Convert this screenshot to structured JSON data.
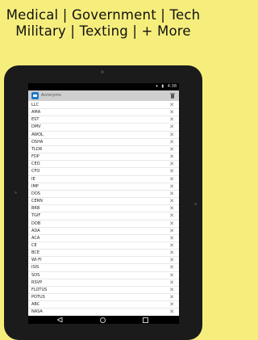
{
  "banner": {
    "line1": "Medical | Government | Tech",
    "line2": "Military | Texting | + More"
  },
  "statusbar": {
    "icons": [
      "wifi-icon",
      "battery-icon"
    ],
    "time": "4:38"
  },
  "toolbar": {
    "title": "Acronyms",
    "icon": "app-icon",
    "action_icon": "trash-icon"
  },
  "list": {
    "items": [
      "LLC",
      "AMA",
      "EST",
      "DMV",
      "AWOL",
      "OSHA",
      "TLDR",
      "FDP",
      "CEO",
      "CFO",
      "IE",
      "IMP",
      "DOS",
      "CERN",
      "BRB",
      "TGIF",
      "DOB",
      "ADA",
      "ACA",
      "CE",
      "BCE",
      "WI-FI",
      "ISIS",
      "SOS",
      "RSVP",
      "FLOTUS",
      "POTUS",
      "ABC",
      "NASA"
    ],
    "remove_glyph": "✕"
  },
  "colors": {
    "background": "#f6ee7c",
    "device": "#1b1b1b",
    "toolbar": "#cfcfcf",
    "accent": "#1f78c8"
  },
  "navbar": {
    "icons": [
      "back-icon",
      "home-icon",
      "recent-apps-icon"
    ]
  }
}
